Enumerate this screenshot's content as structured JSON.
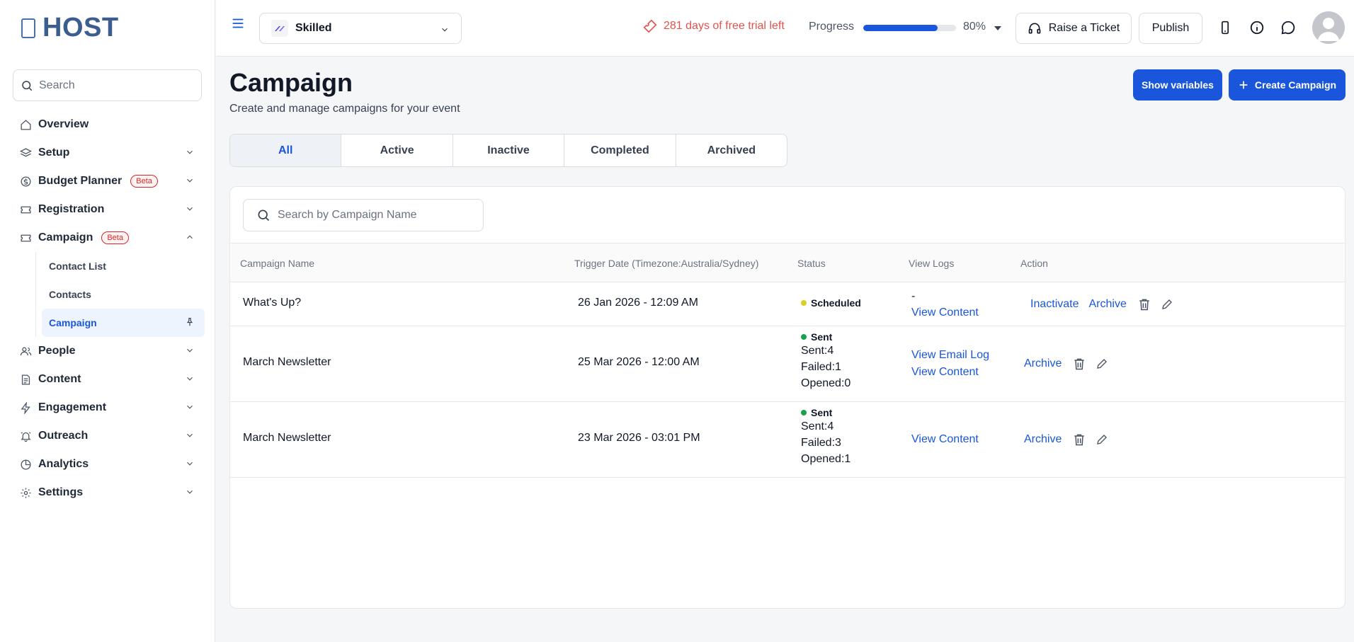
{
  "app": {
    "logo_text": "HOST"
  },
  "sidebar": {
    "search_placeholder": "Search",
    "items": [
      {
        "label": "Overview",
        "icon": "home-icon"
      },
      {
        "label": "Setup",
        "icon": "layers-icon"
      },
      {
        "label": "Budget Planner",
        "badge": "Beta",
        "icon": "dollar-icon"
      },
      {
        "label": "Registration",
        "icon": "ticket-icon"
      },
      {
        "label": "Campaign",
        "badge": "Beta",
        "icon": "ticket-icon",
        "expanded": true
      },
      {
        "label": "People",
        "icon": "users-icon"
      },
      {
        "label": "Content",
        "icon": "document-icon"
      },
      {
        "label": "Engagement",
        "icon": "lightning-icon"
      },
      {
        "label": "Outreach",
        "icon": "bell-icon"
      },
      {
        "label": "Analytics",
        "icon": "pie-chart-icon"
      },
      {
        "label": "Settings",
        "icon": "gear-icon"
      }
    ],
    "campaign_sub": [
      {
        "label": "Contact List"
      },
      {
        "label": "Contacts"
      },
      {
        "label": "Campaign",
        "active": true
      }
    ]
  },
  "header": {
    "event_name": "Skilled",
    "trial_text": "281 days of free trial left",
    "progress_label": "Progress",
    "progress_value": 0.8,
    "progress_pct": "80%",
    "raise_ticket": "Raise a Ticket",
    "publish": "Publish"
  },
  "page": {
    "title": "Campaign",
    "subtitle": "Create and manage campaigns for your event",
    "show_variables": "Show variables",
    "create_campaign": "Create Campaign"
  },
  "tabs": [
    {
      "label": "All",
      "active": true
    },
    {
      "label": "Active"
    },
    {
      "label": "Inactive"
    },
    {
      "label": "Completed"
    },
    {
      "label": "Archived"
    }
  ],
  "table": {
    "search_placeholder": "Search by Campaign Name",
    "headers": [
      "Campaign Name",
      "Trigger Date (Timezone:Australia/Sydney)",
      "Status",
      "View Logs",
      "Action"
    ],
    "rows": [
      {
        "name": "What's Up?",
        "date": "26 Jan 2026 - 12:09 AM",
        "status": "Scheduled",
        "status_color": "#d9d021",
        "logs_dash": "-",
        "view_content": "View Content",
        "inactivate": "Inactivate",
        "archive": "Archive"
      },
      {
        "name": "March Newsletter",
        "date": "25 Mar 2026 - 12:00 AM",
        "status": "Sent",
        "status_color": "#16a34a",
        "sent": "Sent:4",
        "failed": "Failed:1",
        "opened": "Opened:0",
        "view_email_log": "View Email Log",
        "view_content": "View Content",
        "archive": "Archive"
      },
      {
        "name": "March Newsletter",
        "date": "23 Mar 2026 - 03:01 PM",
        "status": "Sent",
        "status_color": "#16a34a",
        "sent": "Sent:4",
        "failed": "Failed:3",
        "opened": "Opened:1",
        "view_content": "View Content",
        "archive": "Archive"
      }
    ]
  },
  "colors": {
    "accent": "#1a56db",
    "trial": "#e2524d",
    "beta": "#dc2626"
  }
}
